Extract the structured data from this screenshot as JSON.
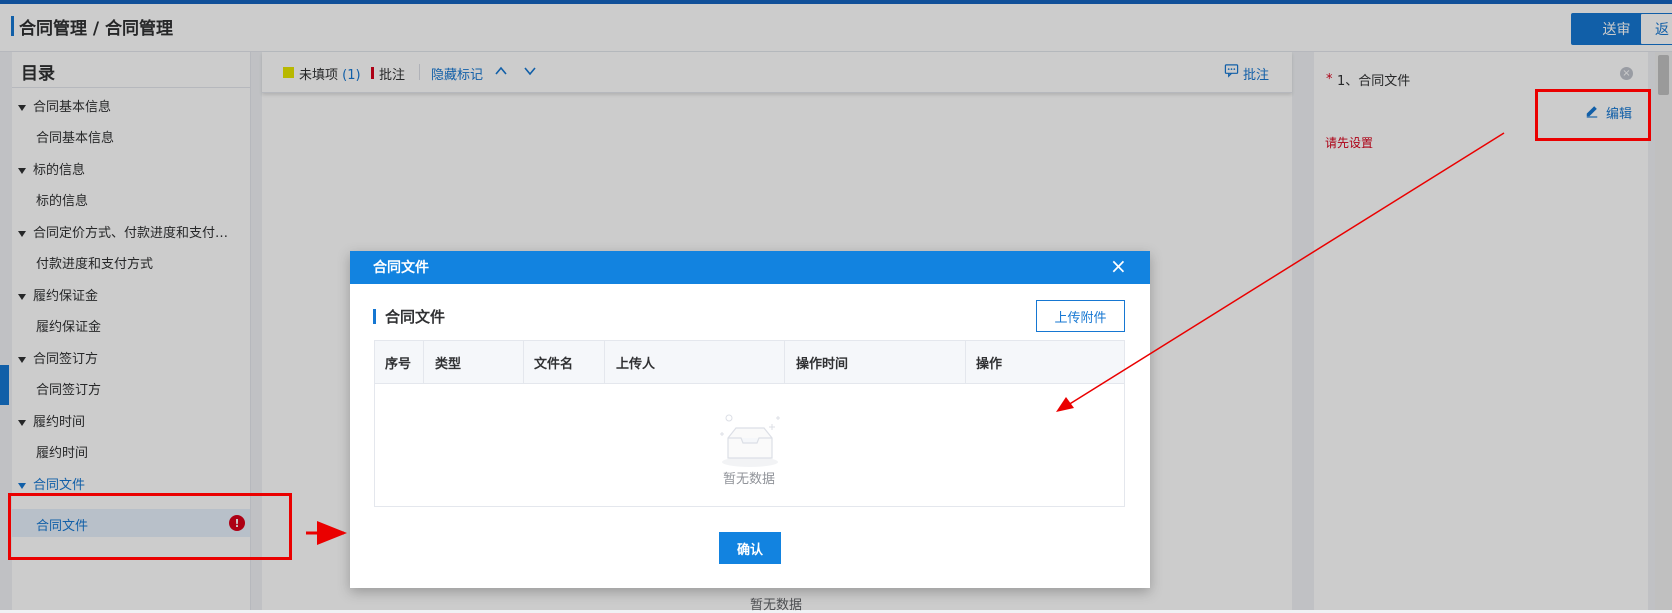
{
  "header": {
    "title": "合同管理 / 合同管理",
    "submit_label": "送审",
    "back_label": "返"
  },
  "sidebar": {
    "title": "目录",
    "groups": [
      {
        "label": "合同基本信息",
        "child": "合同基本信息"
      },
      {
        "label": "标的信息",
        "child": "标的信息"
      },
      {
        "label": "合同定价方式、付款进度和支付…",
        "child": "付款进度和支付方式"
      },
      {
        "label": "履约保证金",
        "child": "履约保证金"
      },
      {
        "label": "合同签订方",
        "child": "合同签订方"
      },
      {
        "label": "履约时间",
        "child": "履约时间"
      },
      {
        "label": "合同文件",
        "child": "合同文件"
      }
    ],
    "error_badge": "!"
  },
  "toolbar": {
    "unfilled_label": "未填项",
    "unfilled_count": "(1)",
    "annotation_label": "批注",
    "hide_marks_label": "隐藏标记",
    "up_icon": "chevron-up-icon",
    "down_icon": "chevron-down-icon",
    "comment_label": "批注"
  },
  "center": {
    "empty_text": "暂无数据"
  },
  "right_panel": {
    "required_mark": "*",
    "item_title": "1、合同文件",
    "edit_label": "编辑",
    "warning": "请先设置"
  },
  "modal": {
    "title": "合同文件",
    "close_glyph": "×",
    "section_title": "合同文件",
    "upload_label": "上传附件",
    "columns": [
      "序号",
      "类型",
      "文件名",
      "上传人",
      "操作时间",
      "操作"
    ],
    "empty_text": "暂无数据",
    "confirm_label": "确认"
  },
  "colors": {
    "primary": "#1677d2",
    "modal_header": "#1283e0",
    "error": "#d9001b",
    "annotation_red": "#ea0000"
  }
}
